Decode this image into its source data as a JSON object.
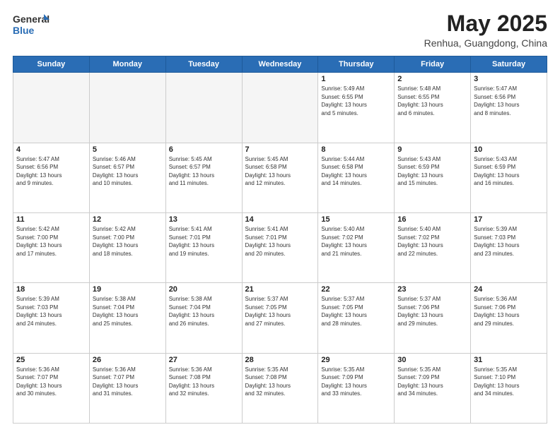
{
  "header": {
    "logo_general": "General",
    "logo_blue": "Blue",
    "title": "May 2025",
    "location": "Renhua, Guangdong, China"
  },
  "weekdays": [
    "Sunday",
    "Monday",
    "Tuesday",
    "Wednesday",
    "Thursday",
    "Friday",
    "Saturday"
  ],
  "weeks": [
    [
      {
        "day": "",
        "info": ""
      },
      {
        "day": "",
        "info": ""
      },
      {
        "day": "",
        "info": ""
      },
      {
        "day": "",
        "info": ""
      },
      {
        "day": "1",
        "info": "Sunrise: 5:49 AM\nSunset: 6:55 PM\nDaylight: 13 hours\nand 5 minutes."
      },
      {
        "day": "2",
        "info": "Sunrise: 5:48 AM\nSunset: 6:55 PM\nDaylight: 13 hours\nand 6 minutes."
      },
      {
        "day": "3",
        "info": "Sunrise: 5:47 AM\nSunset: 6:56 PM\nDaylight: 13 hours\nand 8 minutes."
      }
    ],
    [
      {
        "day": "4",
        "info": "Sunrise: 5:47 AM\nSunset: 6:56 PM\nDaylight: 13 hours\nand 9 minutes."
      },
      {
        "day": "5",
        "info": "Sunrise: 5:46 AM\nSunset: 6:57 PM\nDaylight: 13 hours\nand 10 minutes."
      },
      {
        "day": "6",
        "info": "Sunrise: 5:45 AM\nSunset: 6:57 PM\nDaylight: 13 hours\nand 11 minutes."
      },
      {
        "day": "7",
        "info": "Sunrise: 5:45 AM\nSunset: 6:58 PM\nDaylight: 13 hours\nand 12 minutes."
      },
      {
        "day": "8",
        "info": "Sunrise: 5:44 AM\nSunset: 6:58 PM\nDaylight: 13 hours\nand 14 minutes."
      },
      {
        "day": "9",
        "info": "Sunrise: 5:43 AM\nSunset: 6:59 PM\nDaylight: 13 hours\nand 15 minutes."
      },
      {
        "day": "10",
        "info": "Sunrise: 5:43 AM\nSunset: 6:59 PM\nDaylight: 13 hours\nand 16 minutes."
      }
    ],
    [
      {
        "day": "11",
        "info": "Sunrise: 5:42 AM\nSunset: 7:00 PM\nDaylight: 13 hours\nand 17 minutes."
      },
      {
        "day": "12",
        "info": "Sunrise: 5:42 AM\nSunset: 7:00 PM\nDaylight: 13 hours\nand 18 minutes."
      },
      {
        "day": "13",
        "info": "Sunrise: 5:41 AM\nSunset: 7:01 PM\nDaylight: 13 hours\nand 19 minutes."
      },
      {
        "day": "14",
        "info": "Sunrise: 5:41 AM\nSunset: 7:01 PM\nDaylight: 13 hours\nand 20 minutes."
      },
      {
        "day": "15",
        "info": "Sunrise: 5:40 AM\nSunset: 7:02 PM\nDaylight: 13 hours\nand 21 minutes."
      },
      {
        "day": "16",
        "info": "Sunrise: 5:40 AM\nSunset: 7:02 PM\nDaylight: 13 hours\nand 22 minutes."
      },
      {
        "day": "17",
        "info": "Sunrise: 5:39 AM\nSunset: 7:03 PM\nDaylight: 13 hours\nand 23 minutes."
      }
    ],
    [
      {
        "day": "18",
        "info": "Sunrise: 5:39 AM\nSunset: 7:03 PM\nDaylight: 13 hours\nand 24 minutes."
      },
      {
        "day": "19",
        "info": "Sunrise: 5:38 AM\nSunset: 7:04 PM\nDaylight: 13 hours\nand 25 minutes."
      },
      {
        "day": "20",
        "info": "Sunrise: 5:38 AM\nSunset: 7:04 PM\nDaylight: 13 hours\nand 26 minutes."
      },
      {
        "day": "21",
        "info": "Sunrise: 5:37 AM\nSunset: 7:05 PM\nDaylight: 13 hours\nand 27 minutes."
      },
      {
        "day": "22",
        "info": "Sunrise: 5:37 AM\nSunset: 7:05 PM\nDaylight: 13 hours\nand 28 minutes."
      },
      {
        "day": "23",
        "info": "Sunrise: 5:37 AM\nSunset: 7:06 PM\nDaylight: 13 hours\nand 29 minutes."
      },
      {
        "day": "24",
        "info": "Sunrise: 5:36 AM\nSunset: 7:06 PM\nDaylight: 13 hours\nand 29 minutes."
      }
    ],
    [
      {
        "day": "25",
        "info": "Sunrise: 5:36 AM\nSunset: 7:07 PM\nDaylight: 13 hours\nand 30 minutes."
      },
      {
        "day": "26",
        "info": "Sunrise: 5:36 AM\nSunset: 7:07 PM\nDaylight: 13 hours\nand 31 minutes."
      },
      {
        "day": "27",
        "info": "Sunrise: 5:36 AM\nSunset: 7:08 PM\nDaylight: 13 hours\nand 32 minutes."
      },
      {
        "day": "28",
        "info": "Sunrise: 5:35 AM\nSunset: 7:08 PM\nDaylight: 13 hours\nand 32 minutes."
      },
      {
        "day": "29",
        "info": "Sunrise: 5:35 AM\nSunset: 7:09 PM\nDaylight: 13 hours\nand 33 minutes."
      },
      {
        "day": "30",
        "info": "Sunrise: 5:35 AM\nSunset: 7:09 PM\nDaylight: 13 hours\nand 34 minutes."
      },
      {
        "day": "31",
        "info": "Sunrise: 5:35 AM\nSunset: 7:10 PM\nDaylight: 13 hours\nand 34 minutes."
      }
    ]
  ]
}
